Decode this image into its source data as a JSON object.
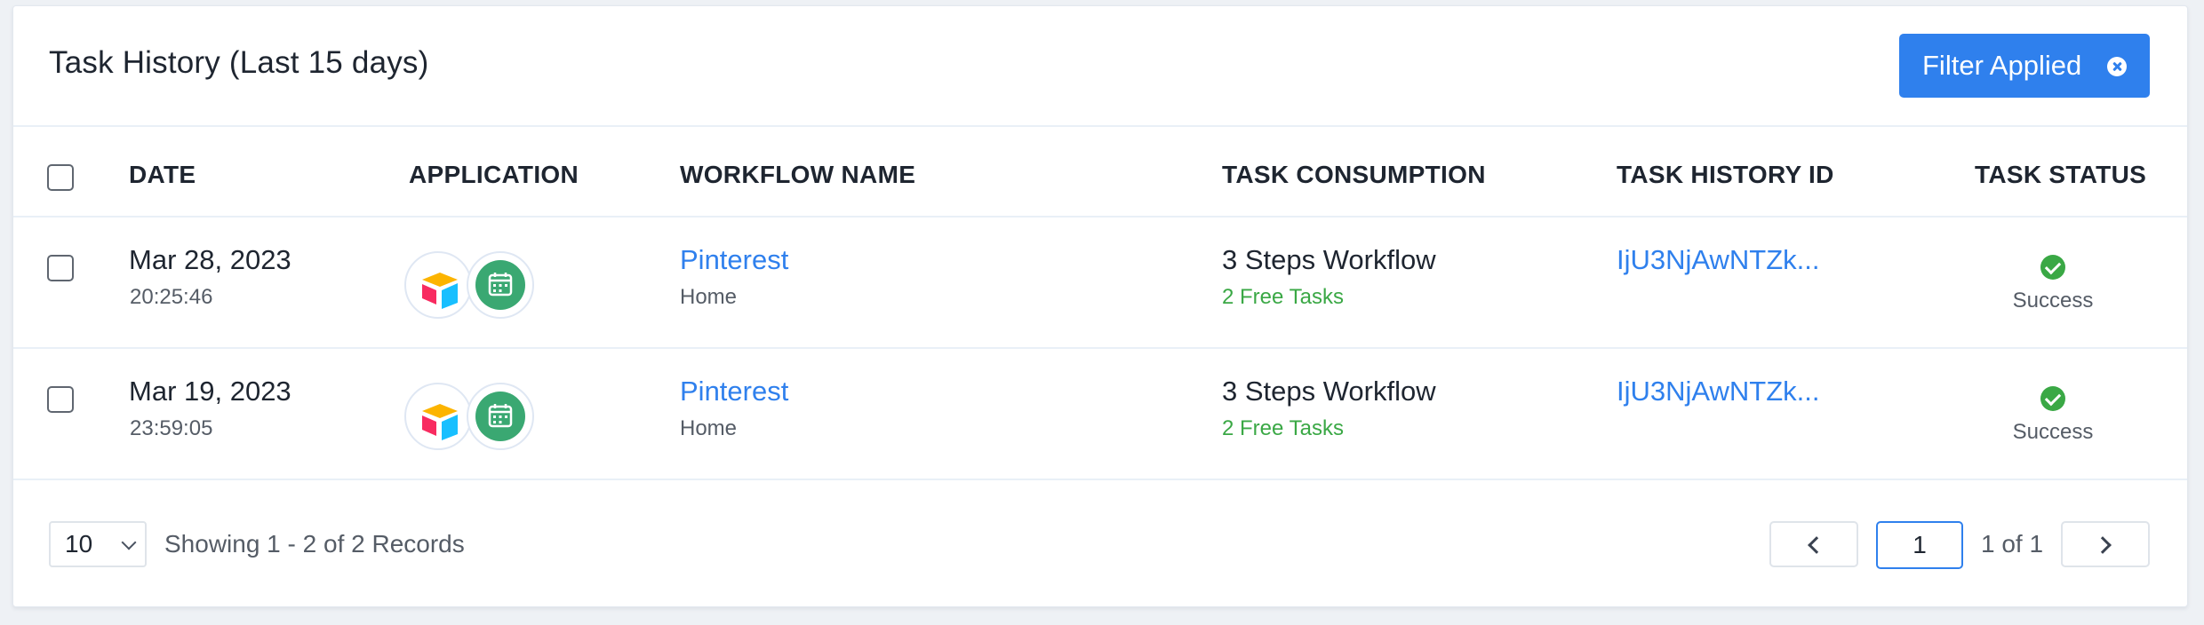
{
  "header": {
    "title": "Task History (Last 15 days)",
    "filter_button_label": "Filter Applied"
  },
  "table": {
    "columns": [
      "DATE",
      "APPLICATION",
      "WORKFLOW NAME",
      "TASK CONSUMPTION",
      "TASK HISTORY ID",
      "TASK STATUS"
    ],
    "rows": [
      {
        "date": "Mar 28, 2023",
        "time": "20:25:46",
        "apps": [
          "airtable-icon",
          "calendar-icon"
        ],
        "workflow_name": "Pinterest",
        "workflow_folder": "Home",
        "task_consumption": "3 Steps Workflow",
        "free_tasks": "2 Free Tasks",
        "task_history_id": "IjU3NjAwNTZk...",
        "status": "Success"
      },
      {
        "date": "Mar 19, 2023",
        "time": "23:59:05",
        "apps": [
          "airtable-icon",
          "calendar-icon"
        ],
        "workflow_name": "Pinterest",
        "workflow_folder": "Home",
        "task_consumption": "3 Steps Workflow",
        "free_tasks": "2 Free Tasks",
        "task_history_id": "IjU3NjAwNTZk...",
        "status": "Success"
      }
    ]
  },
  "footer": {
    "page_size": "10",
    "showing_text": "Showing 1 - 2 of 2 Records",
    "current_page": "1",
    "page_of_text": "1 of 1"
  },
  "colors": {
    "accent": "#2f80ed",
    "success": "#3aa845",
    "text_primary": "#1e2530",
    "text_secondary": "#555c66"
  }
}
